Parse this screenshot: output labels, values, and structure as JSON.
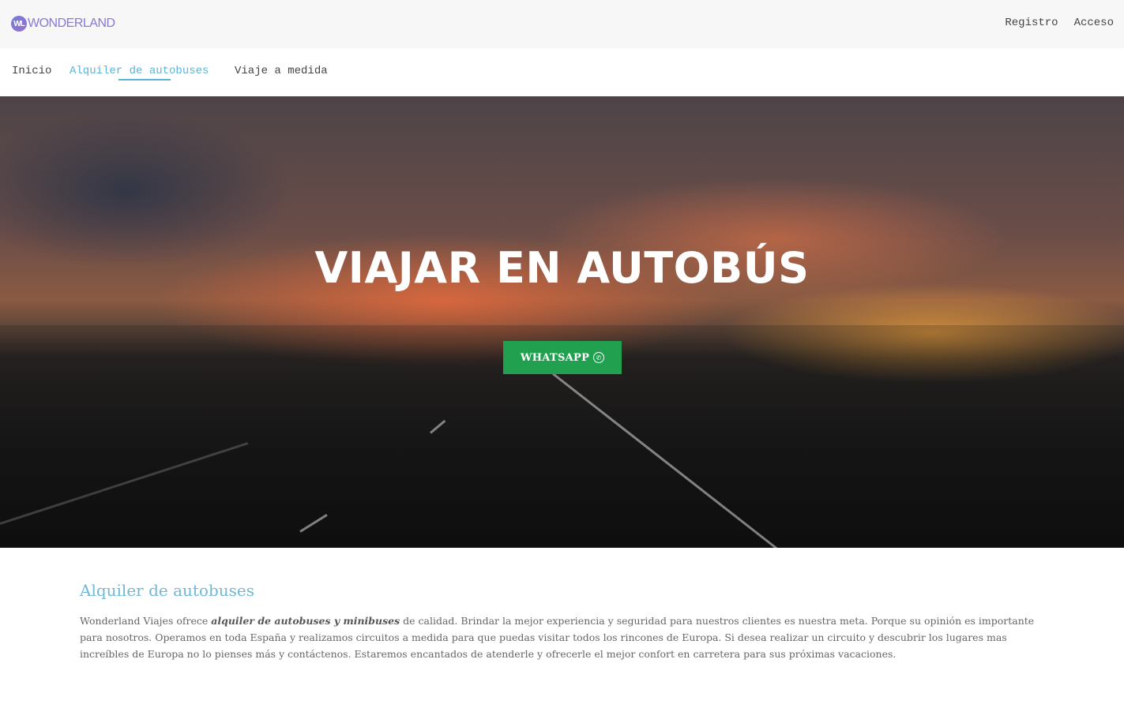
{
  "header": {
    "logo_mark": "WL",
    "logo_text": "WONDERLAND",
    "register_label": "Registro",
    "login_label": "Acceso"
  },
  "nav": {
    "items": [
      {
        "label": "Inicio"
      },
      {
        "label": "Alquiler de autobuses",
        "active": true
      },
      {
        "label": "Viaje a medida"
      }
    ]
  },
  "hero": {
    "title": "VIAJAR EN AUTOBÚS",
    "button_label": "WHATSAPP",
    "button_icon": "whatsapp-icon"
  },
  "section": {
    "heading": "Alquiler de autobuses",
    "text_before": "Wonderland Viajes ofrece ",
    "text_emphasis": "alquiler de autobuses y minibuses",
    "text_after": " de calidad. Brindar la mejor experiencia y seguridad para nuestros clientes es nuestra meta. Porque su opinión es importante para nosotros. Operamos en toda España y realizamos circuitos a medida para que puedas visitar todos los rincones de Europa. Si desea realizar un circuito y descubrir los lugares mas increíbles de Europa no lo pienses más y contáctenos. Estaremos encantados de atenderle y ofrecerle el mejor confort en carretera para sus próximas vacaciones."
  },
  "colors": {
    "accent": "#5bb5d4",
    "whatsapp_green": "#21a150",
    "topbar_bg": "#f7f7f7"
  }
}
